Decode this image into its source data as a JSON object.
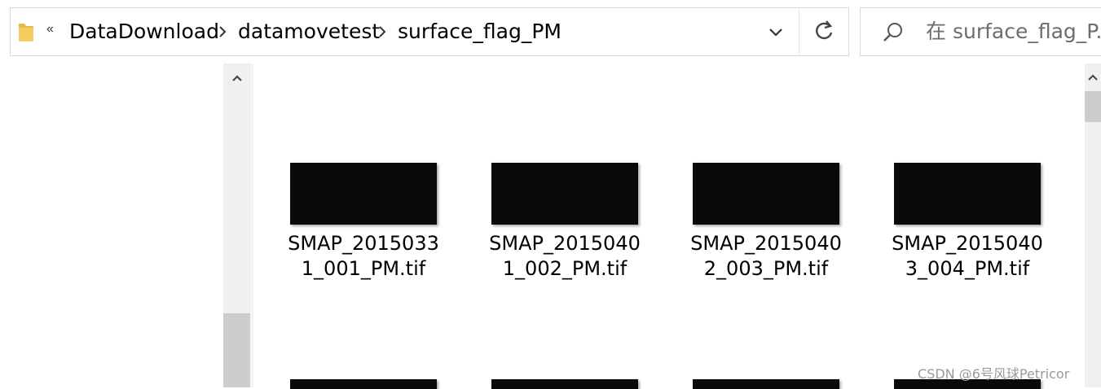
{
  "breadcrumb": {
    "more_glyph": "«",
    "items": [
      "DataDownload",
      "datamovetest",
      "surface_flag_PM"
    ]
  },
  "search": {
    "placeholder": "在 surface_flag_P..."
  },
  "files": [
    {
      "name": "SMAP_20150331_001_PM.tif"
    },
    {
      "name": "SMAP_20150401_002_PM.tif"
    },
    {
      "name": "SMAP_20150402_003_PM.tif"
    },
    {
      "name": "SMAP_20150403_004_PM.tif"
    }
  ],
  "watermark": "CSDN @6号风球Petricor",
  "colors": {
    "thumbnail": "#0a0a0a",
    "folder": "#e8b84a",
    "scrollbar": "#cdcdcd"
  }
}
